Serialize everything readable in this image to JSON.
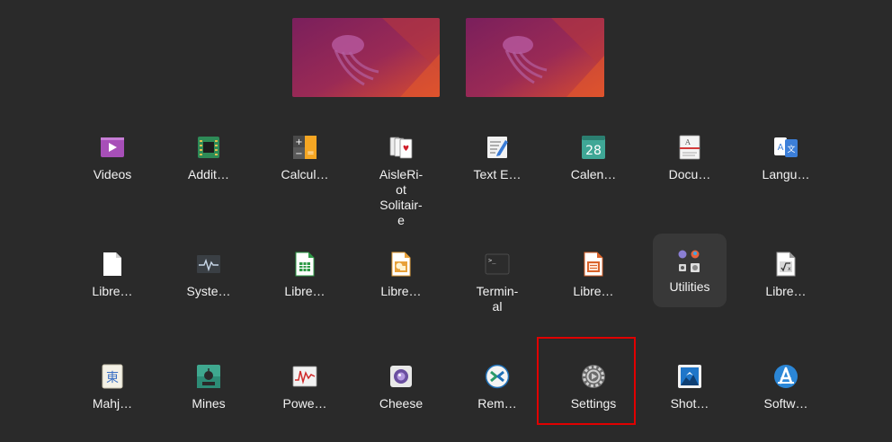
{
  "apps": [
    {
      "label": "Videos",
      "icon": "videos-icon"
    },
    {
      "label": "Addit…",
      "icon": "chip-icon"
    },
    {
      "label": "Calcul…",
      "icon": "calculator-icon"
    },
    {
      "label": "AisleRi-\not\nSolitair-\ne",
      "icon": "cards-icon"
    },
    {
      "label": "Text E…",
      "icon": "text-editor-icon"
    },
    {
      "label": "Calen…",
      "icon": "calendar-icon",
      "day": "28"
    },
    {
      "label": "Docu…",
      "icon": "document-viewer-icon"
    },
    {
      "label": "Langu…",
      "icon": "language-icon"
    },
    {
      "label": "Libre…",
      "icon": "libreoffice-icon"
    },
    {
      "label": "Syste…",
      "icon": "system-monitor-icon"
    },
    {
      "label": "Libre…",
      "icon": "libreoffice-calc-icon"
    },
    {
      "label": "Libre…",
      "icon": "libreoffice-draw-icon"
    },
    {
      "label": "Termin-\nal",
      "icon": "terminal-icon",
      "prompt": ">_"
    },
    {
      "label": "Libre…",
      "icon": "libreoffice-impress-icon"
    },
    {
      "label": "Utilities",
      "icon": "utilities-folder-icon"
    },
    {
      "label": "Libre…",
      "icon": "libreoffice-math-icon"
    },
    {
      "label": "Mahj…",
      "icon": "mahjongg-icon",
      "glyph": "東"
    },
    {
      "label": "Mines",
      "icon": "mines-icon"
    },
    {
      "label": "Powe…",
      "icon": "power-statistics-icon"
    },
    {
      "label": "Cheese",
      "icon": "cheese-icon"
    },
    {
      "label": "Rem…",
      "icon": "remmina-icon"
    },
    {
      "label": "Settings",
      "icon": "settings-gear-icon"
    },
    {
      "label": "Shot…",
      "icon": "shotwell-icon"
    },
    {
      "label": "Softw…",
      "icon": "software-icon"
    }
  ],
  "colors": {
    "background": "#2a2a2a",
    "highlight": "#e00000",
    "folder_tile": "#383838"
  }
}
